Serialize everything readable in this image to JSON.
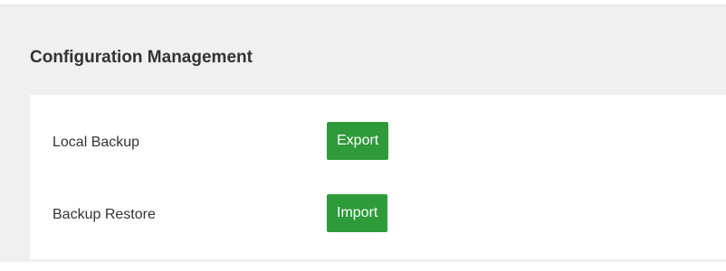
{
  "section": {
    "title": "Configuration Management",
    "rows": [
      {
        "label": "Local Backup",
        "button_label": "Export"
      },
      {
        "label": "Backup Restore",
        "button_label": "Import"
      }
    ]
  },
  "colors": {
    "button_bg": "#2f9a3a",
    "panel_bg": "#f0f0f0",
    "body_bg": "#ffffff"
  }
}
